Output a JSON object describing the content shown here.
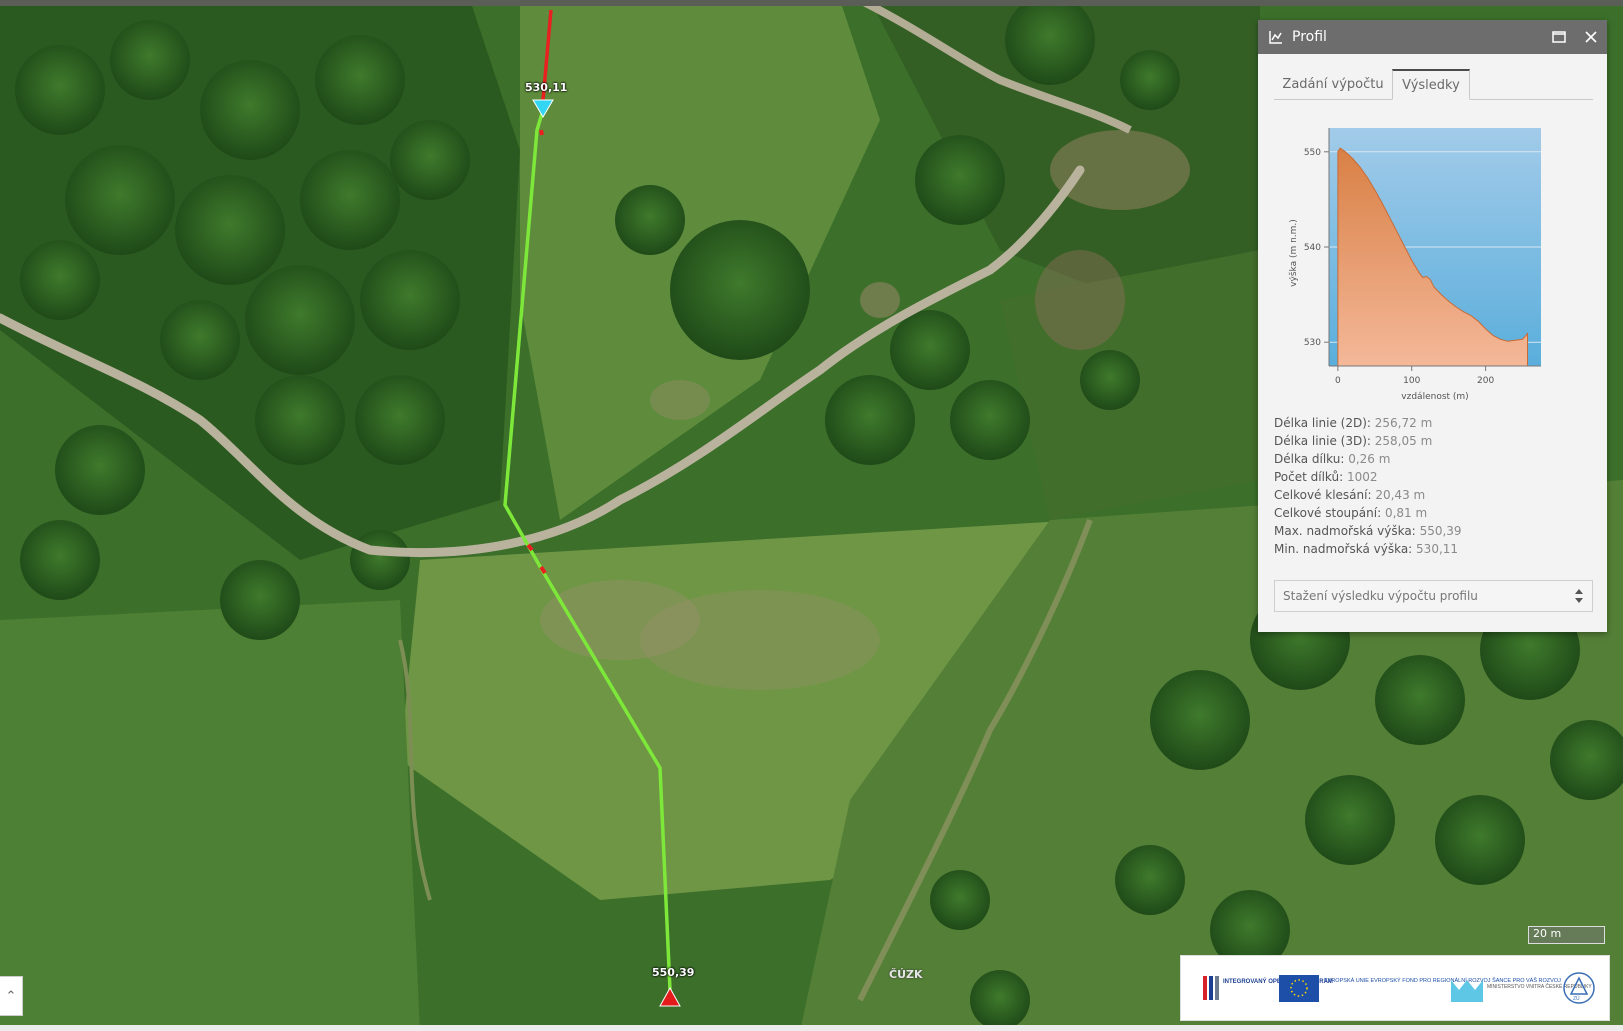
{
  "map": {
    "start_point_label": "530,11",
    "end_point_label": "550,39",
    "attribution": "ČÚZK",
    "scale_label": "20 m",
    "colors": {
      "profile_line": "#7ee83a",
      "profile_error_segment": "#e82020",
      "start_marker": "#33d6f2",
      "end_marker": "#e31b1b"
    }
  },
  "panel": {
    "title": "Profil",
    "header_icon": "chart-icon",
    "maximize_icon": "maximize-icon",
    "close_icon": "close-icon",
    "tabs": [
      {
        "label": "Zadání výpočtu",
        "active": false
      },
      {
        "label": "Výsledky",
        "active": true
      }
    ],
    "stats": [
      {
        "label": "Délka linie (2D):",
        "value": "256,72 m"
      },
      {
        "label": "Délka linie (3D):",
        "value": "258,05 m"
      },
      {
        "label": "Délka dílku:",
        "value": "0,26 m"
      },
      {
        "label": "Počet dílků:",
        "value": "1002"
      },
      {
        "label": "Celkové klesání:",
        "value": "20,43 m"
      },
      {
        "label": "Celkové stoupání:",
        "value": "0,81 m"
      },
      {
        "label": "Max. nadmořská výška:",
        "value": "550,39"
      },
      {
        "label": "Min. nadmořská výška:",
        "value": "530,11"
      }
    ],
    "download_select": {
      "selected": "Stažení výsledku výpočtu profilu"
    }
  },
  "chart_data": {
    "type": "area",
    "ylabel": "výška (m n.m.)",
    "xlabel": "vzdálenost (m)",
    "xlim": [
      -12,
      275
    ],
    "ylim": [
      527.5,
      552.5
    ],
    "xticks": [
      "0",
      "100",
      "200"
    ],
    "xtick_values": [
      0,
      100,
      200
    ],
    "yticks": [
      "530",
      "540",
      "550"
    ],
    "ytick_values": [
      530,
      540,
      550
    ],
    "grid": true,
    "series": [
      {
        "x": [
          0,
          3,
          10,
          20,
          30,
          40,
          50,
          60,
          70,
          80,
          90,
          100,
          110,
          115,
          120,
          125,
          130,
          140,
          150,
          160,
          170,
          180,
          190,
          200,
          210,
          220,
          230,
          240,
          250,
          256.72
        ],
        "y": [
          550.0,
          550.39,
          550.0,
          549.3,
          548.4,
          547.3,
          546.0,
          544.6,
          543.1,
          541.6,
          540.1,
          538.6,
          537.3,
          536.8,
          536.9,
          536.6,
          535.8,
          535.0,
          534.3,
          533.7,
          533.2,
          532.8,
          532.2,
          531.4,
          530.7,
          530.3,
          530.11,
          530.2,
          530.3,
          530.9
        ]
      }
    ],
    "colors": {
      "area_top": "#d98045",
      "area_bottom": "#f4b899",
      "background_top": "#a2cbe9",
      "background_bottom": "#5aaedc",
      "line": "#c96a33"
    }
  },
  "logos": [
    {
      "name": "IROP logo",
      "text": "INTEGROVANÝ OPERAČNÍ PROGRAM"
    },
    {
      "name": "EU flag",
      "text": "EVROPSKÁ UNIE EVROPSKÝ FOND PRO REGIONÁLNÍ ROZVOJ ŠANCE PRO VÁŠ ROZVOJ"
    },
    {
      "name": "MV logo",
      "text": "MINISTERSTVO VNITRA ČESKÉ REPUBLIKY"
    },
    {
      "name": "ZU logo",
      "text": "ZÚ"
    }
  ]
}
